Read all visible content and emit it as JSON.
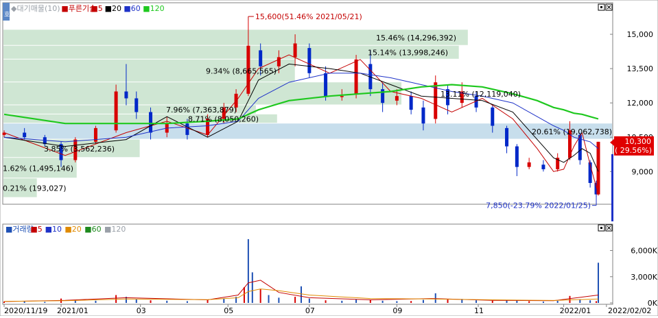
{
  "chart_data": [
    {
      "type": "line",
      "title": "",
      "price_legend": [
        {
          "name": "◆대기매물(10)",
          "color": "#9aa0a8"
        },
        {
          "name": "■푸른기술",
          "color": "#c40000"
        },
        {
          "name": "■5",
          "color": "#c40000"
        },
        {
          "name": "■20",
          "color": "#000000"
        },
        {
          "name": "■60",
          "color": "#1e32c8"
        },
        {
          "name": "■120",
          "color": "#1ec81e"
        }
      ],
      "ylim": [
        7600,
        16200
      ],
      "y_ticks": [
        "15,000",
        "13,500",
        "12,000",
        "10,500",
        "9,000"
      ],
      "y_tick_values": [
        15000,
        13500,
        12000,
        10500,
        9000
      ],
      "x_ticks": [
        "2020/11/19",
        "2021/01",
        "03",
        "05",
        "07",
        "09",
        "11",
        "2022/01",
        "2022/02/02"
      ],
      "x_tick_values": [
        0,
        28,
        67,
        110,
        150,
        193,
        233,
        275,
        296
      ],
      "series": [
        {
          "name": "5",
          "color": "#c40000",
          "x": [
            0,
            30,
            60,
            80,
            100,
            115,
            125,
            140,
            160,
            175,
            190,
            205,
            220,
            235,
            250,
            262,
            270,
            275,
            280,
            284,
            288,
            292
          ],
          "values": [
            10700,
            9700,
            10700,
            11200,
            10600,
            12200,
            13500,
            14100,
            13300,
            13900,
            12500,
            12200,
            11600,
            12200,
            11300,
            10000,
            9000,
            9100,
            10100,
            10700,
            9300,
            8000
          ]
        },
        {
          "name": "20",
          "color": "#000000",
          "x": [
            0,
            30,
            60,
            80,
            100,
            115,
            125,
            140,
            160,
            175,
            190,
            205,
            220,
            235,
            250,
            262,
            270,
            275,
            280,
            284,
            288,
            292
          ],
          "values": [
            10500,
            10100,
            10400,
            11400,
            10500,
            11200,
            13000,
            13700,
            13500,
            13300,
            12800,
            12300,
            12200,
            12100,
            11600,
            10400,
            9600,
            9400,
            9700,
            10000,
            9800,
            9000
          ]
        },
        {
          "name": "60",
          "color": "#1e32c8",
          "x": [
            0,
            30,
            60,
            80,
            100,
            115,
            125,
            140,
            160,
            175,
            190,
            205,
            220,
            235,
            250,
            262,
            270,
            275,
            280,
            284,
            288,
            292
          ],
          "values": [
            10500,
            10300,
            10500,
            10900,
            11000,
            11200,
            12200,
            12900,
            13300,
            13300,
            13100,
            12800,
            12500,
            12300,
            12000,
            11400,
            11000,
            10800,
            10500,
            10400,
            10300,
            10000
          ]
        },
        {
          "name": "120",
          "color": "#1ec81e",
          "x": [
            0,
            30,
            60,
            80,
            100,
            115,
            125,
            140,
            160,
            175,
            190,
            205,
            220,
            235,
            250,
            262,
            270,
            275,
            280,
            284,
            288,
            292
          ],
          "values": [
            11500,
            11100,
            11100,
            11100,
            11200,
            11300,
            11700,
            12100,
            12300,
            12400,
            12500,
            12700,
            12800,
            12700,
            12400,
            12100,
            11800,
            11700,
            11550,
            11500,
            11400,
            11300
          ]
        }
      ],
      "price_bars": [
        {
          "x": 0,
          "o": 10600,
          "h": 10800,
          "l": 10500,
          "c": 10700
        },
        {
          "x": 10,
          "o": 10700,
          "h": 10900,
          "l": 10400,
          "c": 10500
        },
        {
          "x": 20,
          "o": 10500,
          "h": 10600,
          "l": 10100,
          "c": 10200
        },
        {
          "x": 28,
          "o": 10200,
          "h": 10300,
          "l": 9200,
          "c": 9500
        },
        {
          "x": 35,
          "o": 9500,
          "h": 10500,
          "l": 9400,
          "c": 10400
        },
        {
          "x": 45,
          "o": 10300,
          "h": 11000,
          "l": 10200,
          "c": 10900
        },
        {
          "x": 55,
          "o": 10800,
          "h": 12800,
          "l": 10700,
          "c": 12500
        },
        {
          "x": 60,
          "o": 12500,
          "h": 13700,
          "l": 11900,
          "c": 12200
        },
        {
          "x": 65,
          "o": 12200,
          "h": 12500,
          "l": 11300,
          "c": 11600
        },
        {
          "x": 72,
          "o": 11600,
          "h": 11800,
          "l": 10400,
          "c": 10700
        },
        {
          "x": 80,
          "o": 10700,
          "h": 11400,
          "l": 10500,
          "c": 11100
        },
        {
          "x": 90,
          "o": 11100,
          "h": 11300,
          "l": 10400,
          "c": 10600
        },
        {
          "x": 100,
          "o": 10600,
          "h": 11500,
          "l": 10500,
          "c": 11300
        },
        {
          "x": 108,
          "o": 11300,
          "h": 12000,
          "l": 11100,
          "c": 11800
        },
        {
          "x": 114,
          "o": 11800,
          "h": 12600,
          "l": 11600,
          "c": 12400
        },
        {
          "x": 120,
          "o": 12400,
          "h": 15600,
          "l": 12300,
          "c": 14500
        },
        {
          "x": 126,
          "o": 14300,
          "h": 14600,
          "l": 13200,
          "c": 13600
        },
        {
          "x": 135,
          "o": 13600,
          "h": 14300,
          "l": 13300,
          "c": 14000
        },
        {
          "x": 143,
          "o": 14000,
          "h": 15000,
          "l": 13600,
          "c": 14600
        },
        {
          "x": 150,
          "o": 14400,
          "h": 14600,
          "l": 13100,
          "c": 13300
        },
        {
          "x": 158,
          "o": 13300,
          "h": 13600,
          "l": 12100,
          "c": 12300
        },
        {
          "x": 166,
          "o": 12300,
          "h": 12600,
          "l": 12100,
          "c": 12300
        },
        {
          "x": 173,
          "o": 12400,
          "h": 14100,
          "l": 12200,
          "c": 13900
        },
        {
          "x": 180,
          "o": 13700,
          "h": 14300,
          "l": 12300,
          "c": 12600
        },
        {
          "x": 186,
          "o": 12600,
          "h": 12900,
          "l": 11600,
          "c": 12000
        },
        {
          "x": 193,
          "o": 12100,
          "h": 12600,
          "l": 11900,
          "c": 12300
        },
        {
          "x": 200,
          "o": 12300,
          "h": 12500,
          "l": 11500,
          "c": 11700
        },
        {
          "x": 206,
          "o": 11800,
          "h": 12100,
          "l": 10800,
          "c": 11100
        },
        {
          "x": 212,
          "o": 11300,
          "h": 13200,
          "l": 11100,
          "c": 12900
        },
        {
          "x": 218,
          "o": 12600,
          "h": 12800,
          "l": 11500,
          "c": 11900
        },
        {
          "x": 225,
          "o": 12000,
          "h": 12900,
          "l": 11800,
          "c": 12500
        },
        {
          "x": 232,
          "o": 12300,
          "h": 12500,
          "l": 11600,
          "c": 11800
        },
        {
          "x": 240,
          "o": 11800,
          "h": 11900,
          "l": 10700,
          "c": 11000
        },
        {
          "x": 247,
          "o": 10900,
          "h": 11000,
          "l": 9800,
          "c": 10100
        },
        {
          "x": 252,
          "o": 10100,
          "h": 10200,
          "l": 8800,
          "c": 9200
        },
        {
          "x": 258,
          "o": 9200,
          "h": 9600,
          "l": 9100,
          "c": 9400
        },
        {
          "x": 265,
          "o": 9300,
          "h": 9500,
          "l": 9000,
          "c": 9100
        },
        {
          "x": 272,
          "o": 9100,
          "h": 9800,
          "l": 9000,
          "c": 9600
        },
        {
          "x": 278,
          "o": 9600,
          "h": 11200,
          "l": 9500,
          "c": 10800
        },
        {
          "x": 283,
          "o": 10600,
          "h": 10700,
          "l": 9300,
          "c": 9500
        },
        {
          "x": 288,
          "o": 9400,
          "h": 9500,
          "l": 8300,
          "c": 8500
        },
        {
          "x": 291,
          "o": 8500,
          "h": 8600,
          "l": 7850,
          "c": 8000
        },
        {
          "x": 292,
          "o": 8000,
          "h": 10300,
          "l": 7950,
          "c": 10300
        }
      ],
      "volume_profile": [
        {
          "label": "15.46% (14,296,392)",
          "low": 14500,
          "high": 15200
        },
        {
          "label": "15.14% (13,998,246)",
          "low": 13900,
          "high": 14500
        },
        {
          "label": "9.34% (8,665,565)",
          "low": 12900,
          "high": 13900
        },
        {
          "label": "13.11% (12,119,040)",
          "low": 11900,
          "high": 12900
        },
        {
          "label": "7.96% (7,363,879)",
          "low": 11500,
          "high": 11900
        },
        {
          "label": "8.71% (8,050,260)",
          "low": 11100,
          "high": 11500
        },
        {
          "label": "20.61% (19,062,738)",
          "low": 10400,
          "high": 11100
        },
        {
          "label": "3.85% (3,562,236)",
          "low": 9600,
          "high": 10400
        },
        {
          "label": "1.62% (1,495,146)",
          "low": 8700,
          "high": 9600
        },
        {
          "label": "0.21% (193,027)",
          "low": 7850,
          "high": 8700
        }
      ],
      "annotations": [
        {
          "text": "15,600(51.46% 2021/05/21)",
          "x": 120,
          "y": 15600,
          "color": "#c40000",
          "kind": "high"
        },
        {
          "text": "7,850(-23.79% 2022/01/25)",
          "x": 291,
          "y": 7850,
          "color": "#1e32c8",
          "kind": "low"
        }
      ],
      "current_price": {
        "value": 10300,
        "label": "10,300",
        "change_label": "( 29.56%)"
      }
    },
    {
      "type": "bar",
      "title": "",
      "volume_legend": [
        {
          "name": "■거래량",
          "color": "#1e50b4"
        },
        {
          "name": "■5",
          "color": "#c40000"
        },
        {
          "name": "■10",
          "color": "#1e32c8"
        },
        {
          "name": "■20",
          "color": "#e08a00"
        },
        {
          "name": "■60",
          "color": "#1e8a1e"
        },
        {
          "name": "■120",
          "color": "#9aa0a8"
        }
      ],
      "ylim": [
        0,
        8000
      ],
      "y_ticks": [
        "6,000K",
        "3,000K",
        "0K"
      ],
      "y_tick_values": [
        6000,
        3000,
        0
      ],
      "x": [
        0,
        10,
        20,
        28,
        35,
        45,
        55,
        60,
        65,
        72,
        80,
        90,
        100,
        108,
        114,
        118,
        120,
        122,
        126,
        130,
        135,
        143,
        146,
        150,
        158,
        166,
        173,
        180,
        186,
        193,
        200,
        206,
        212,
        218,
        225,
        232,
        240,
        247,
        252,
        258,
        265,
        272,
        278,
        283,
        288,
        291,
        292
      ],
      "values": [
        150,
        180,
        120,
        500,
        300,
        250,
        900,
        700,
        400,
        300,
        250,
        200,
        350,
        500,
        700,
        1800,
        7300,
        3500,
        1600,
        900,
        600,
        700,
        1900,
        500,
        300,
        250,
        400,
        350,
        250,
        200,
        220,
        350,
        1100,
        400,
        450,
        300,
        250,
        300,
        350,
        200,
        150,
        250,
        800,
        400,
        300,
        200,
        4600
      ],
      "ma5": {
        "x": [
          0,
          30,
          60,
          100,
          115,
          120,
          126,
          135,
          150,
          180,
          210,
          240,
          270,
          292
        ],
        "values": [
          160,
          300,
          600,
          350,
          900,
          2300,
          2600,
          1200,
          600,
          350,
          500,
          300,
          250,
          900
        ]
      },
      "ma20": {
        "x": [
          0,
          30,
          60,
          100,
          115,
          120,
          126,
          135,
          150,
          180,
          210,
          240,
          270,
          292
        ],
        "values": [
          170,
          250,
          450,
          380,
          600,
          1300,
          1600,
          1400,
          900,
          500,
          450,
          350,
          280,
          450
        ]
      }
    }
  ]
}
